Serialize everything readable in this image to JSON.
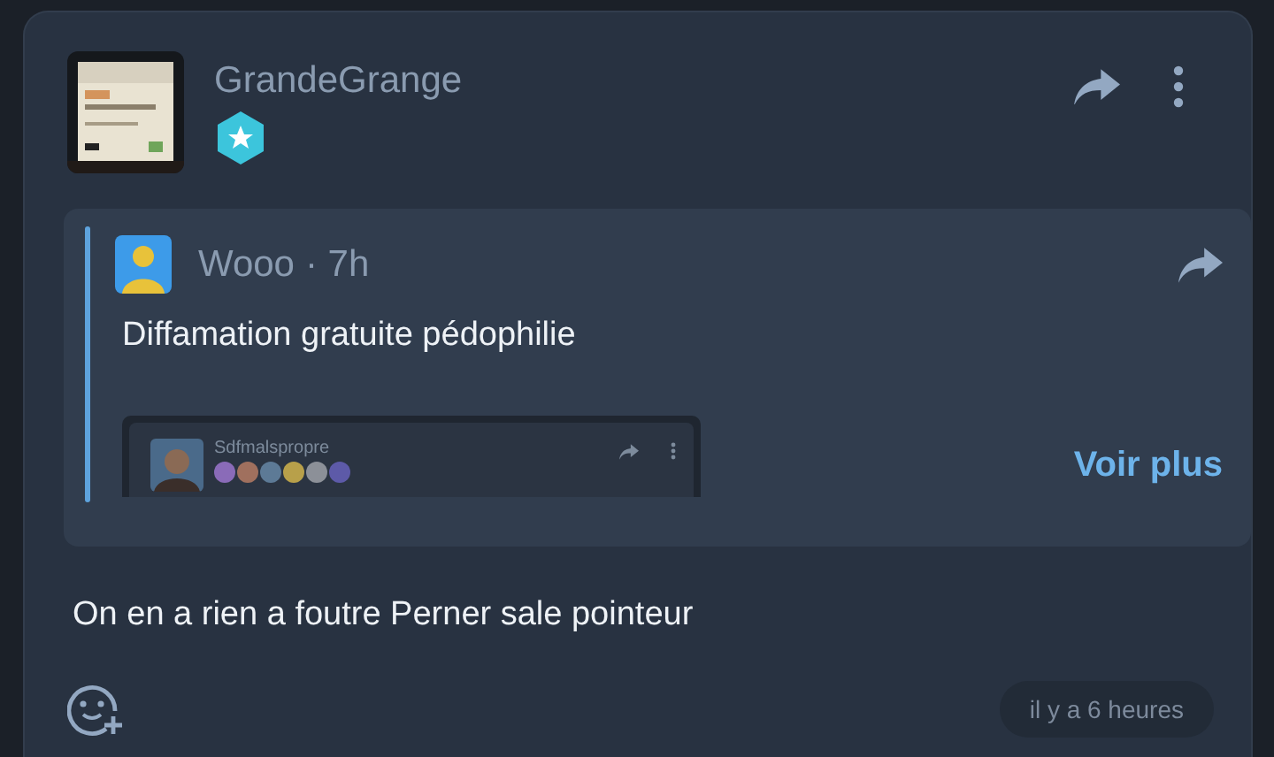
{
  "post": {
    "author": "GrandeGrange",
    "quote": {
      "author": "Wooo",
      "time": "· 7h",
      "text": "Diffamation gratuite pédophilie",
      "embedded": {
        "author": "Sdfmalspropre",
        "badges": [
          {
            "color": "#8a6bb8"
          },
          {
            "color": "#a0705e"
          },
          {
            "color": "#5d7a96"
          },
          {
            "color": "#b8a04a"
          },
          {
            "color": "#8c9098"
          },
          {
            "color": "#5d5aa8"
          }
        ]
      },
      "more": "Voir plus"
    },
    "text": "On en a rien a foutre Perner sale pointeur",
    "timestamp": "il y a 6 heures"
  }
}
